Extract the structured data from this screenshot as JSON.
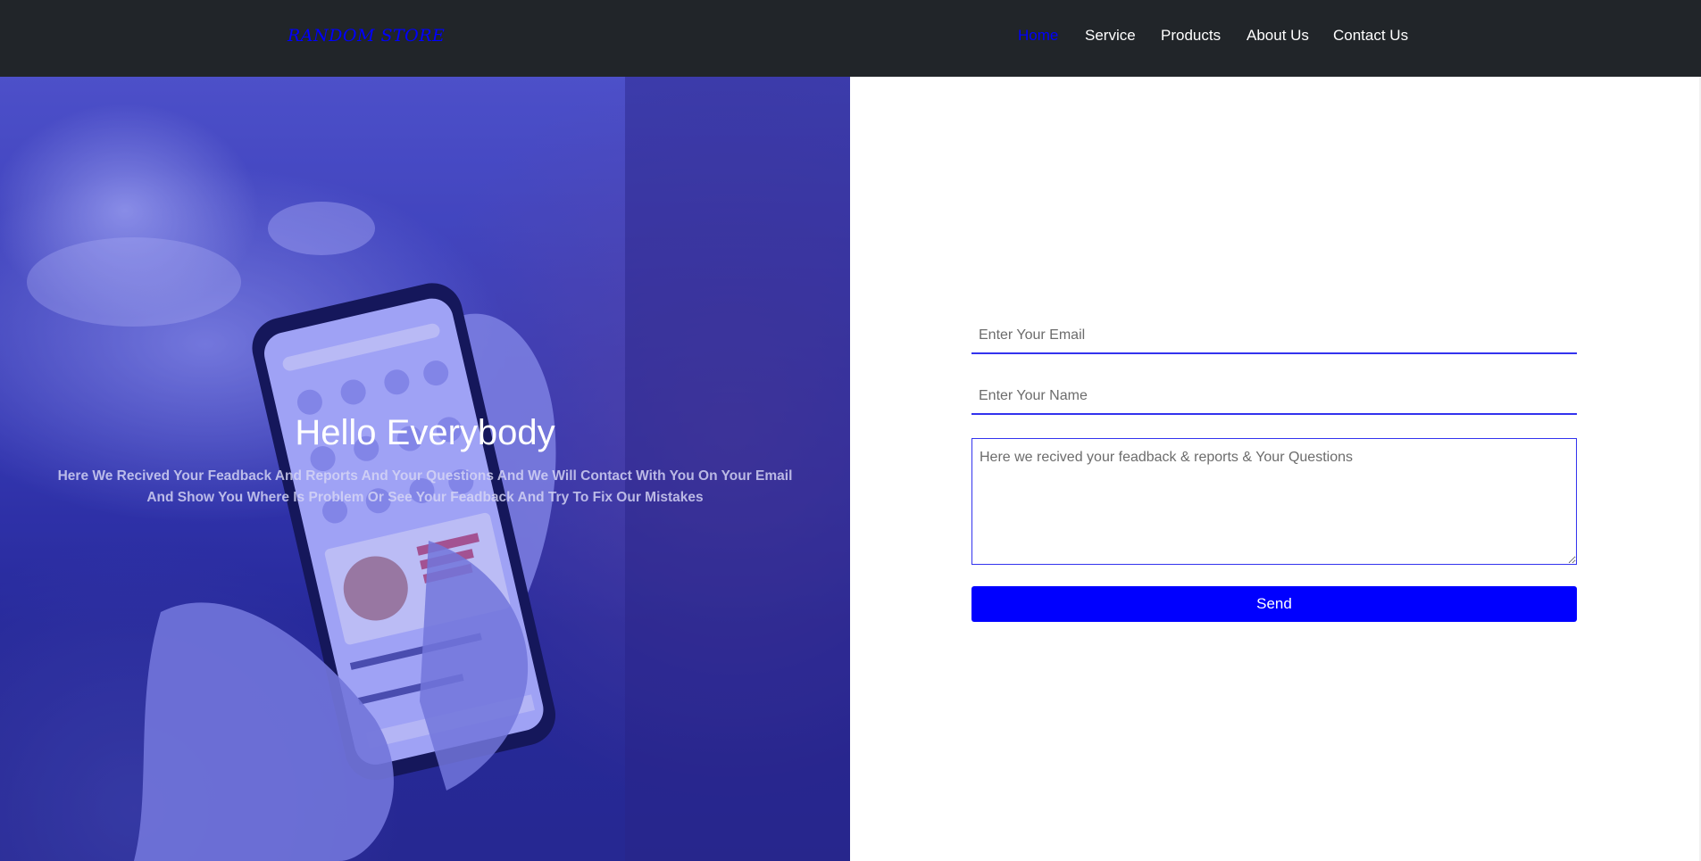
{
  "navbar": {
    "brand": "RANDOM STORE",
    "items": [
      {
        "label": "Home",
        "active": true
      },
      {
        "label": "Service",
        "active": false
      },
      {
        "label": "Products",
        "active": false
      },
      {
        "label": "About Us",
        "active": false
      },
      {
        "label": "Contact Us",
        "active": false
      }
    ]
  },
  "hero": {
    "title": "Hello Everybody",
    "text": "Here We Recived Your Feadback And Reports And Your Questions And We Will Contact With You On Your Email And Show You Where Is Problem Or See Your Feadback And Try To Fix Our Mistakes",
    "image": "hand-holding-phone-food-app",
    "overlay_color": "#0000ff"
  },
  "form": {
    "email_placeholder": "Enter Your Email",
    "name_placeholder": "Enter Your Name",
    "message_placeholder": "Here we recived your feadback & reports & Your Questions",
    "send_label": "Send"
  },
  "colors": {
    "navbar_bg": "#212529",
    "accent": "#0000ff",
    "white": "#ffffff"
  }
}
